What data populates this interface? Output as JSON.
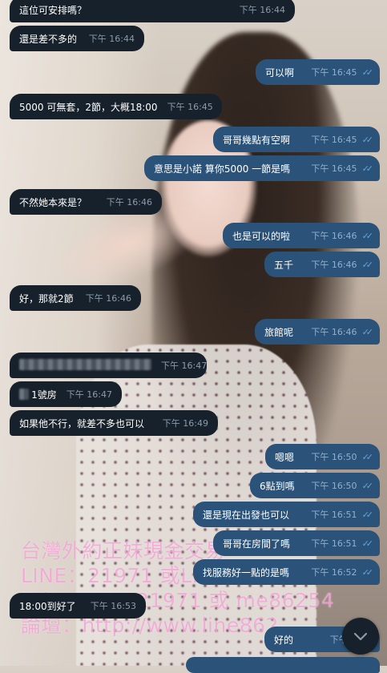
{
  "messages": [
    {
      "dir": "in",
      "text": "這位可安排嗎？",
      "time": "下午 16:44"
    },
    {
      "dir": "in",
      "text": "還是差不多的",
      "time": "下午 16:44"
    },
    {
      "dir": "out",
      "text": "可以啊",
      "time": "下午 16:45"
    },
    {
      "dir": "in",
      "text": "5000 可無套，2節，大概18:00",
      "time": "下午 16:45"
    },
    {
      "dir": "out",
      "text": "哥哥幾點有空啊",
      "time": "下午 16:45"
    },
    {
      "dir": "out",
      "text": "意思是小諾 算你5000 一節是嗎",
      "time": "下午 16:45"
    },
    {
      "dir": "in",
      "text": "不然她本來是？",
      "time": "下午 16:46"
    },
    {
      "dir": "out",
      "text": "也是可以的啦",
      "time": "下午 16:46"
    },
    {
      "dir": "out",
      "text": "五千",
      "time": "下午 16:46"
    },
    {
      "dir": "in",
      "text": "好，那就2節",
      "time": "下午 16:46"
    },
    {
      "dir": "out",
      "text": "旅館呢",
      "time": "下午 16:46"
    },
    {
      "dir": "in",
      "text": "",
      "time": "下午 16:47"
    },
    {
      "dir": "in",
      "text": "1號房",
      "time": "下午 16:47"
    },
    {
      "dir": "in",
      "text": "如果他不行，就差不多也可以",
      "time": "下午 16:49"
    },
    {
      "dir": "out",
      "text": "嗯嗯",
      "time": "下午 16:50"
    },
    {
      "dir": "out",
      "text": "6點到嗎",
      "time": "下午 16:50"
    },
    {
      "dir": "out",
      "text": "還是現在出發也可以",
      "time": "下午 16:51"
    },
    {
      "dir": "out",
      "text": "哥哥在房間了嗎",
      "time": "下午 16:51"
    },
    {
      "dir": "out",
      "text": "找服務好一點的是嗎",
      "time": "下午 16:52"
    },
    {
      "dir": "in",
      "text": "18:00到好了",
      "time": "下午 16:53"
    },
    {
      "dir": "out",
      "text": "好的",
      "time": "下午 16:5"
    }
  ],
  "watermark": {
    "line1": "台灣外約正妹現金交易",
    "line2": "LINE：21971 或LINE：86254",
    "line3": "Telegram：21971 或 me86254",
    "line4": "論壇：http://www.line862"
  },
  "icons": {
    "read": "double-check-icon",
    "scroll": "chevron-down-icon"
  },
  "colors": {
    "incoming": "#17212b",
    "outgoing": "#2b5278",
    "time": "#8c9aa8"
  }
}
